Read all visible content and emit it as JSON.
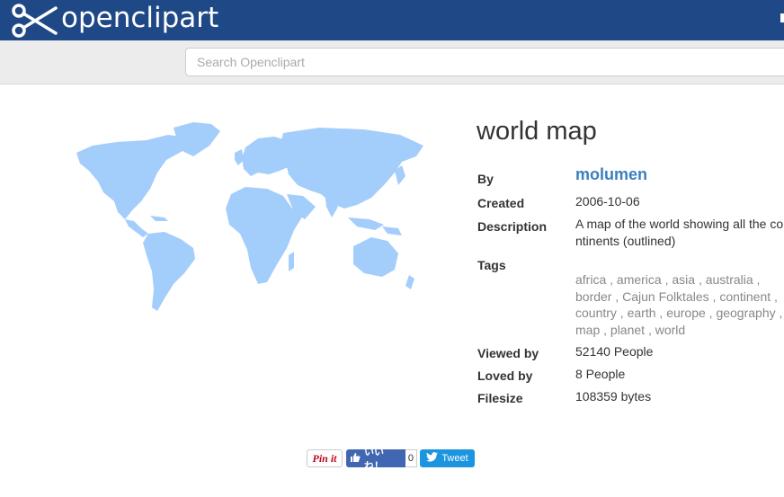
{
  "header": {
    "logo_text": "openclipart"
  },
  "search": {
    "placeholder": "Search Openclipart"
  },
  "clipart": {
    "title": "world map",
    "image_alt": "world map",
    "by_label": "By",
    "author": "molumen",
    "created_label": "Created",
    "created": "2006-10-06",
    "description_label": "Description",
    "description": "A map of the world showing all the continents (outlined)",
    "tags_label": "Tags",
    "tags": [
      "africa",
      "america",
      "asia",
      "australia",
      "border",
      "Cajun Folktales",
      "continent",
      "country",
      "earth",
      "europe",
      "geography",
      "map",
      "planet",
      "world"
    ],
    "viewed_label": "Viewed by",
    "viewed": "52140 People",
    "loved_label": "Loved by",
    "loved": "8 People",
    "filesize_label": "Filesize",
    "filesize": "108359 bytes"
  },
  "social": {
    "pin_label": "Pin it",
    "like_label": "いいね！",
    "like_count": "0",
    "tweet_label": "Tweet"
  },
  "colors": {
    "header_bg": "#1f4886",
    "link": "#3a7fc1",
    "map_fill": "#a3cdfa",
    "like_bg": "#4267b2",
    "tweet_bg": "#1b95e0",
    "pin_red": "#bd081c"
  },
  "icons": {
    "logo": "scissors-icon",
    "like": "thumbs-up-icon",
    "tweet": "twitter-bird-icon"
  }
}
